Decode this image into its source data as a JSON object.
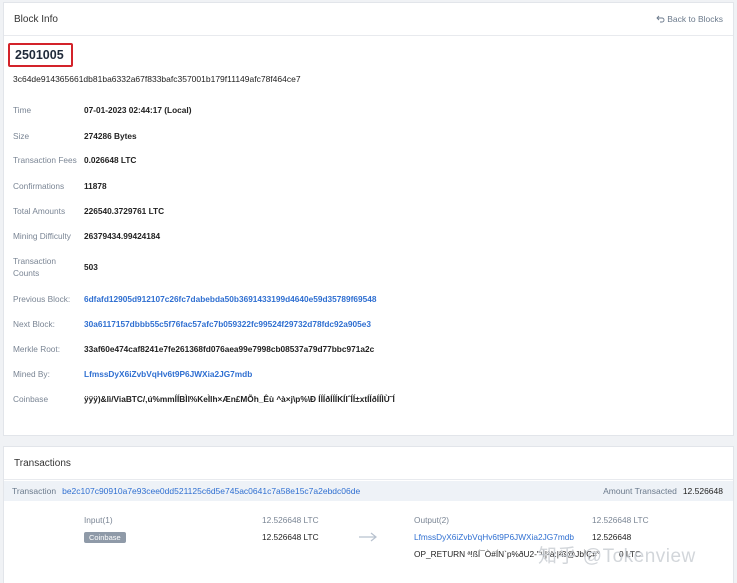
{
  "block_card": {
    "title": "Block Info",
    "back_label": "Back to Blocks",
    "height": "2501005",
    "hash": "3c64de914365661db81ba6332a67f833bafc357001b179f11149afc78f464ce7"
  },
  "info": {
    "time": {
      "label": "Time",
      "value": "07-01-2023 02:44:17 (Local)"
    },
    "size": {
      "label": "Size",
      "value": "274286 Bytes"
    },
    "fees": {
      "label": "Transaction Fees",
      "value": "0.026648 LTC"
    },
    "confirmations": {
      "label": "Confirmations",
      "value": "11878"
    },
    "total": {
      "label": "Total Amounts",
      "value": "226540.3729761 LTC"
    },
    "difficulty": {
      "label": "Mining Difficulty",
      "value": "26379434.99424184"
    },
    "tx_counts": {
      "label": "Transaction Counts",
      "value": "503"
    },
    "prev": {
      "label": "Previous Block:",
      "value": "6dfafd12905d912107c26fc7dabebda50b3691433199d4640e59d35789f69548"
    },
    "next": {
      "label": "Next Block:",
      "value": "30a6117157dbbb55c5f76fac57afc7b059322fc99524f29732d78fdc92a905e3"
    },
    "merkle": {
      "label": "Merkle Root:",
      "value": "33af60e474caf8241e7fe261368fd076aea99e7998cb08537a79d77bbc971a2c"
    },
    "mined_by": {
      "label": "Mined By:",
      "value": "LfmssDyX6iZvbVqHv6t9P6JWXia2JG7mdb"
    },
    "coinbase": {
      "label": "Coinbase",
      "value": "ÿÿÿ)&lì/ViaBTC/‚ú%mmÍÍBÌI%KeÌlh×Æn£MÕh_Êù ^à×j\\p%\\Ð ÍÍÍðÍÍÍKÍIˆÍÍ±xtÍÍðÍÍÌÙ˜Í"
    }
  },
  "tx_card": {
    "title": "Transactions",
    "tx_label": "Transaction",
    "tx_hash": "be2c107c90910a7e93cee0dd521125c6d5e745ac0641c7a58e15c7a2ebdc06de",
    "amount_label": "Amount Transacted",
    "amount": "12.526648",
    "input_label": "Input(1)",
    "input_amount_head": "12.526648 LTC",
    "coinbase_badge": "Coinbase",
    "input_amount": "12.526648 LTC",
    "output_label": "Output(2)",
    "output_amount_head": "12.526648 LTC",
    "output_address": "LfmssDyX6iZvbVqHv6t9P6JWXia2JG7mdb",
    "output_amount": "12.526648",
    "op_return": "OP_RETURN ª!ßÍ¯Ò#ÍN`p%ðU2-\"¹Ì¦²à:|²ß@JbÌÇ#°",
    "op_return_amount": "0 LTC"
  },
  "watermark": "知乎 @Tokenview"
}
